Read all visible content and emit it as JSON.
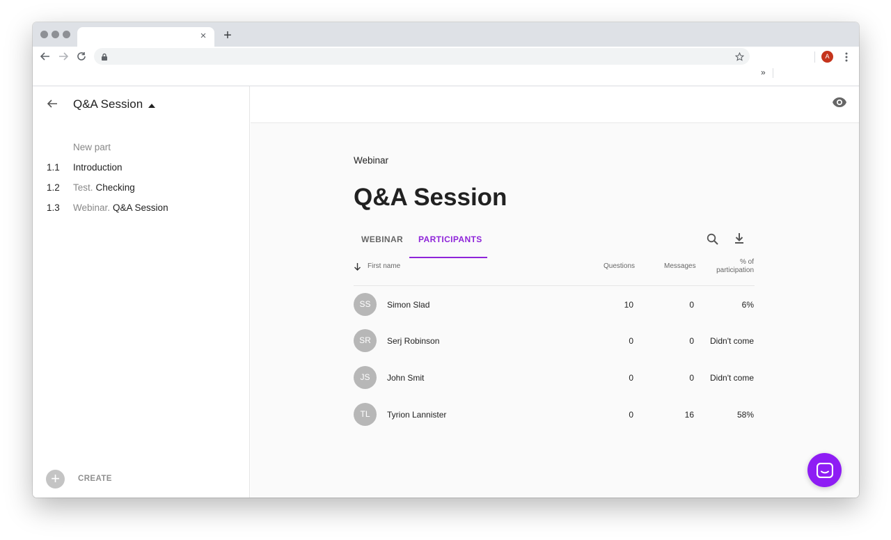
{
  "browser": {
    "tab_title": "",
    "tab_close": "×",
    "new_tab": "+",
    "bookmarks_more": "»",
    "profile_initial": "A"
  },
  "sidebar": {
    "title": "Q&A Session",
    "new_part": "New part",
    "items": [
      {
        "number": "1.1",
        "prefix": "",
        "label": "Introduction"
      },
      {
        "number": "1.2",
        "prefix": "Test.",
        "label": "Checking"
      },
      {
        "number": "1.3",
        "prefix": "Webinar.",
        "label": "Q&A Session"
      }
    ],
    "create_label": "CREATE",
    "create_icon": "+"
  },
  "main": {
    "kicker": "Webinar",
    "title": "Q&A Session",
    "tabs": [
      {
        "label": "WEBINAR",
        "active": false
      },
      {
        "label": "PARTICIPANTS",
        "active": true
      }
    ],
    "accent_color": "#8e24d9",
    "table": {
      "headers": {
        "name": "First name",
        "questions": "Questions",
        "messages": "Messages",
        "percent_line1": "% of",
        "percent_line2": "participation"
      },
      "rows": [
        {
          "initials": "SS",
          "name": "Simon Slad",
          "questions": "10",
          "messages": "0",
          "participation": "6%"
        },
        {
          "initials": "SR",
          "name": "Serj Robinson",
          "questions": "0",
          "messages": "0",
          "participation": "Didn't come"
        },
        {
          "initials": "JS",
          "name": "John Smit",
          "questions": "0",
          "messages": "0",
          "participation": "Didn't come"
        },
        {
          "initials": "TL",
          "name": "Tyrion Lannister",
          "questions": "0",
          "messages": "16",
          "participation": "58%"
        }
      ]
    }
  },
  "icons": {
    "back": "arrow-left-icon",
    "preview": "eye-icon",
    "search": "search-icon",
    "download": "download-icon",
    "sort": "arrow-down-icon",
    "chat": "chat-icon"
  }
}
